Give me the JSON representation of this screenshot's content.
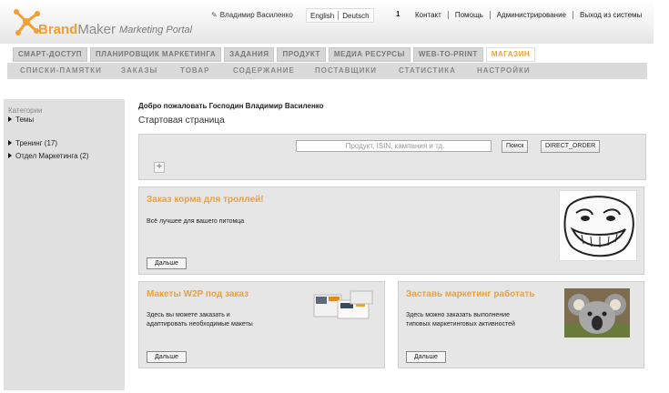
{
  "brand": {
    "name_bold": "Brand",
    "name_rest": "Maker",
    "subtitle": "Marketing Portal"
  },
  "header": {
    "user": "Владимир Василенко",
    "languages": [
      "English",
      "Deutsch"
    ],
    "badge": "1",
    "links": [
      "Контакт",
      "Помощь",
      "Администрирование",
      "Выход из системы"
    ]
  },
  "tabs": [
    "СМАРТ-ДОСТУП",
    "ПЛАНИРОВЩИК МАРКЕТИНГА",
    "ЗАДАНИЯ",
    "ПРОДУКТ",
    "МЕДИА РЕСУРСЫ",
    "WEB-TO-PRINT",
    "МАГАЗИН"
  ],
  "subnav": [
    "СПИСКИ-ПАМЯТКИ",
    "ЗАКАЗЫ",
    "ТОВАР",
    "СОДЕРЖАНИЕ",
    "ПОСТАВЩИКИ",
    "СТАТИСТИКА",
    "НАСТРОЙКИ"
  ],
  "sidebar": {
    "caption": "Категории",
    "items": [
      "Темы",
      "Тренинг (17)",
      "Отдел Маркетинга (2)"
    ]
  },
  "main": {
    "welcome": "Добро пожаловать Господин Владимир Василенко",
    "page_title": "Стартовая страница",
    "search_placeholder": "Продукт, ISIN, кампания и тд.",
    "search_button": "Поиск",
    "direct_order_button": "DIRECT_ORDER",
    "plus": "+"
  },
  "cards": [
    {
      "title": "Заказ корма для троллей!",
      "desc": "Всё лучшее для вашего питомца",
      "more": "Дальше",
      "image": "troll-face-image"
    },
    {
      "title": "Макеты W2P под заказ",
      "desc1": "Здесь вы можете заказать и",
      "desc2": "адаптировать необходимые макеты",
      "more": "Дальше",
      "image": "product-boxes-image"
    },
    {
      "title": "Заставь маркетинг работать",
      "desc1": "Здесь можно заказать выполнение",
      "desc2": "типовых маркетинговых активностей",
      "more": "Дальше",
      "image": "koala-image"
    }
  ],
  "colors": {
    "accent": "#f0a033",
    "panel": "#e6e6e6",
    "subnav": "#dadada"
  }
}
